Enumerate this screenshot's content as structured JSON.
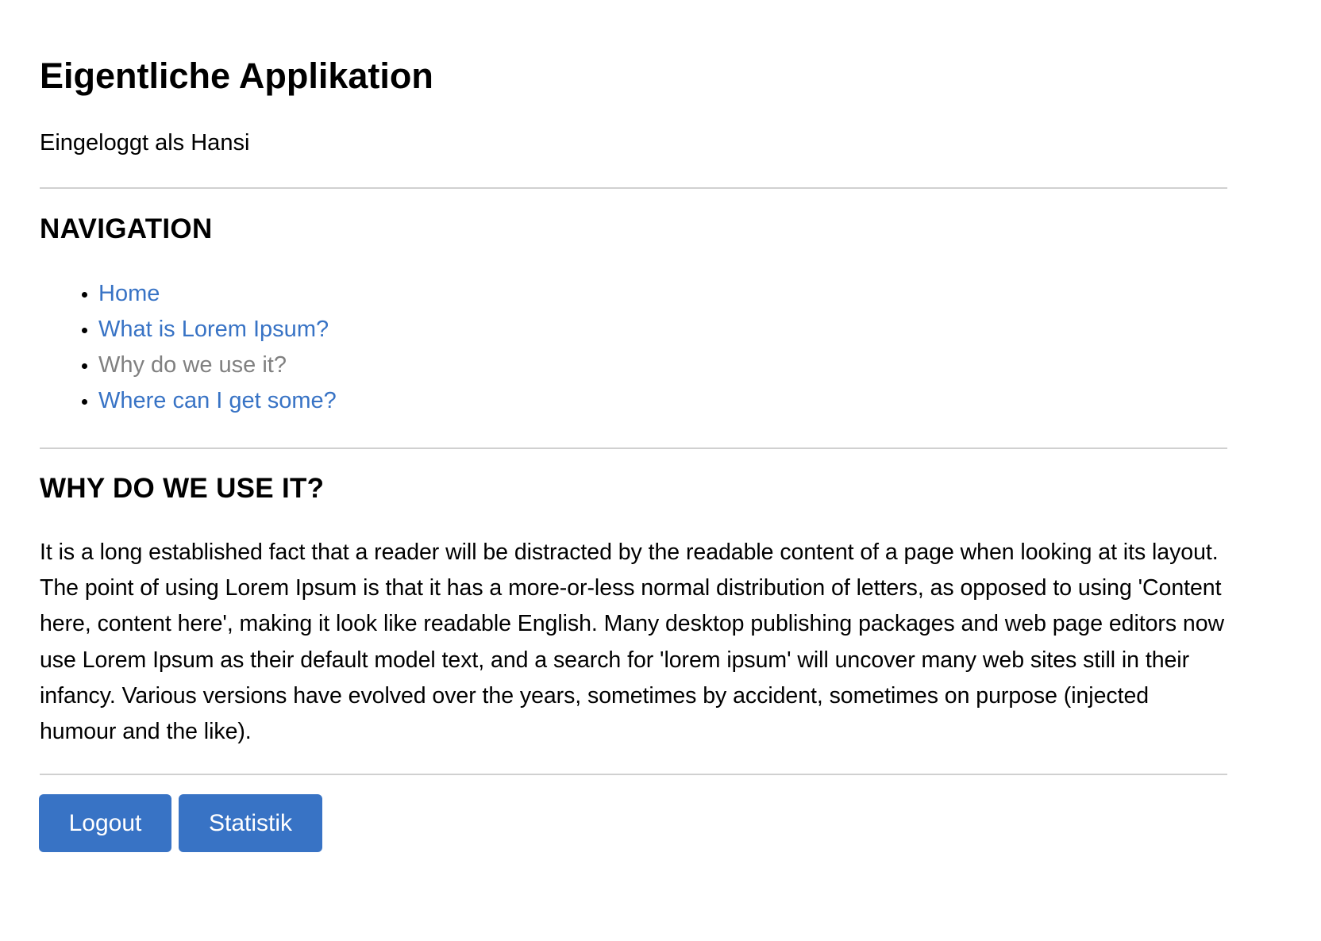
{
  "header": {
    "title": "Eigentliche Applikation",
    "login_status": "Eingeloggt als Hansi"
  },
  "navigation": {
    "heading": "NAVIGATION",
    "items": [
      {
        "label": "Home",
        "current": false
      },
      {
        "label": "What is Lorem Ipsum?",
        "current": false
      },
      {
        "label": "Why do we use it?",
        "current": true
      },
      {
        "label": "Where can I get some?",
        "current": false
      }
    ]
  },
  "content": {
    "heading": "WHY DO WE USE IT?",
    "body": "It is a long established fact that a reader will be distracted by the readable content of a page when looking at its layout. The point of using Lorem Ipsum is that it has a more-or-less normal distribution of letters, as opposed to using 'Content here, content here', making it look like readable English. Many desktop publishing packages and web page editors now use Lorem Ipsum as their default model text, and a search for 'lorem ipsum' will uncover many web sites still in their infancy. Various versions have evolved over the years, sometimes by accident, sometimes on purpose (injected humour and the like)."
  },
  "actions": {
    "logout_label": "Logout",
    "stats_label": "Statistik"
  },
  "colors": {
    "link": "#3873c5",
    "current_item": "#808080",
    "button_bg": "#3873c5",
    "divider": "#d0d0d0"
  }
}
